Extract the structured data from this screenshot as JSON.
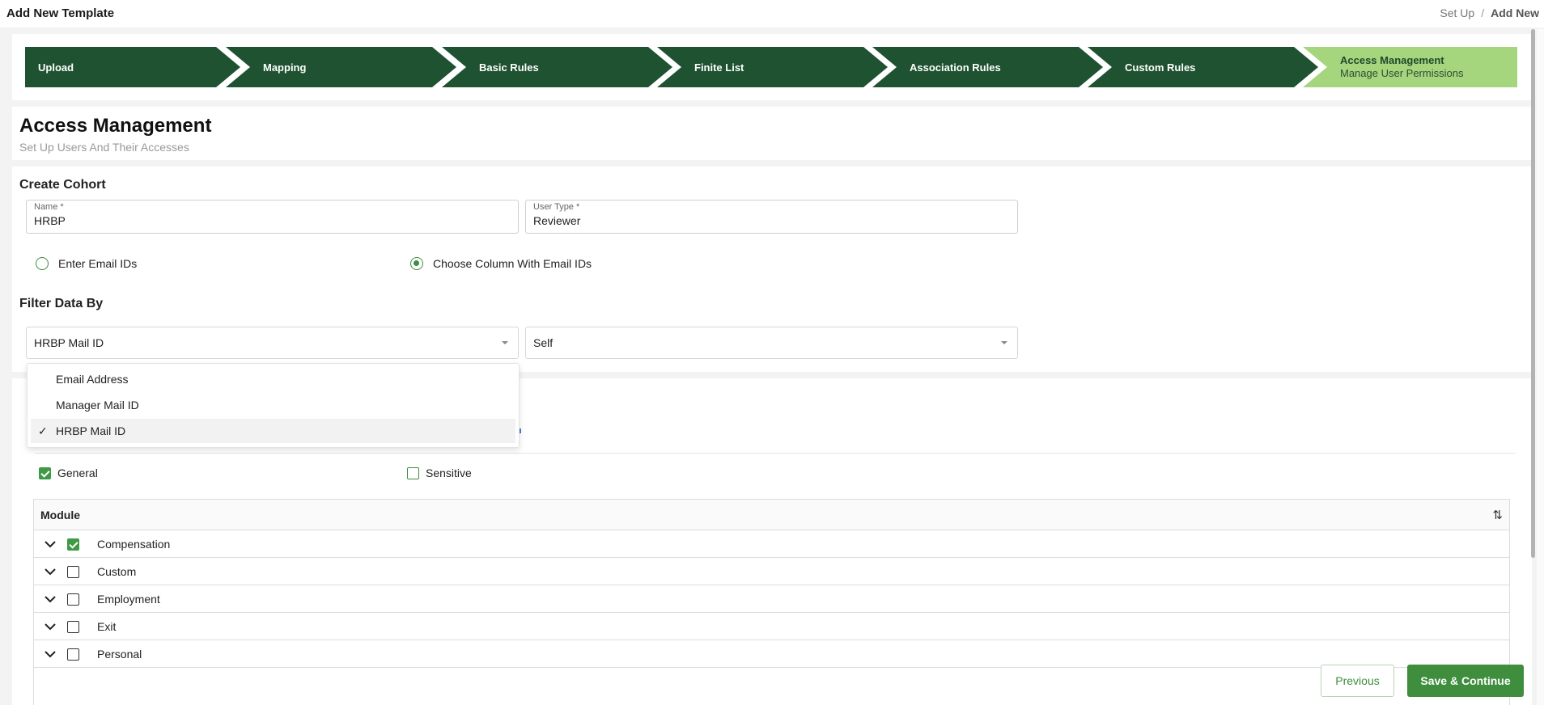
{
  "header": {
    "title": "Add New Template",
    "breadcrumb": [
      "Set Up",
      "/",
      "Add New"
    ]
  },
  "stepper": {
    "steps": [
      {
        "label": "Upload"
      },
      {
        "label": "Mapping"
      },
      {
        "label": "Basic Rules"
      },
      {
        "label": "Finite List"
      },
      {
        "label": "Association Rules"
      },
      {
        "label": "Custom Rules"
      },
      {
        "label": "Access Management",
        "sub": "Manage User Permissions"
      }
    ],
    "active_color": "#a5d57d",
    "done_color": "#1e5230"
  },
  "section": {
    "title": "Access Management",
    "subtitle": "Set Up Users And Their Accesses"
  },
  "cohort": {
    "title": "Create Cohort",
    "name_label": "Name *",
    "name_value": "HRBP",
    "user_type_label": "User Type *",
    "user_type_value": "Reviewer",
    "radio_email": "Enter Email IDs",
    "radio_column": "Choose Column With Email IDs",
    "selected_radio": "column"
  },
  "filter": {
    "title": "Filter Data By",
    "column_value": "HRBP Mail ID",
    "relation_value": "Self",
    "options": [
      "Email Address",
      "Manager Mail ID",
      "HRBP Mail ID"
    ],
    "selected_option": "HRBP Mail ID"
  },
  "access": {
    "general_label": "General",
    "general_checked": true,
    "sensitive_label": "Sensitive",
    "sensitive_checked": false
  },
  "table": {
    "header": "Module",
    "rows": [
      {
        "label": "Compensation",
        "checked": true
      },
      {
        "label": "Custom",
        "checked": false
      },
      {
        "label": "Employment",
        "checked": false
      },
      {
        "label": "Exit",
        "checked": false
      },
      {
        "label": "Personal",
        "checked": false
      }
    ]
  },
  "footer": {
    "previous_label": "Previous",
    "save_label": "Save & Continue"
  },
  "colors": {
    "accent": "#3e8e3e"
  }
}
